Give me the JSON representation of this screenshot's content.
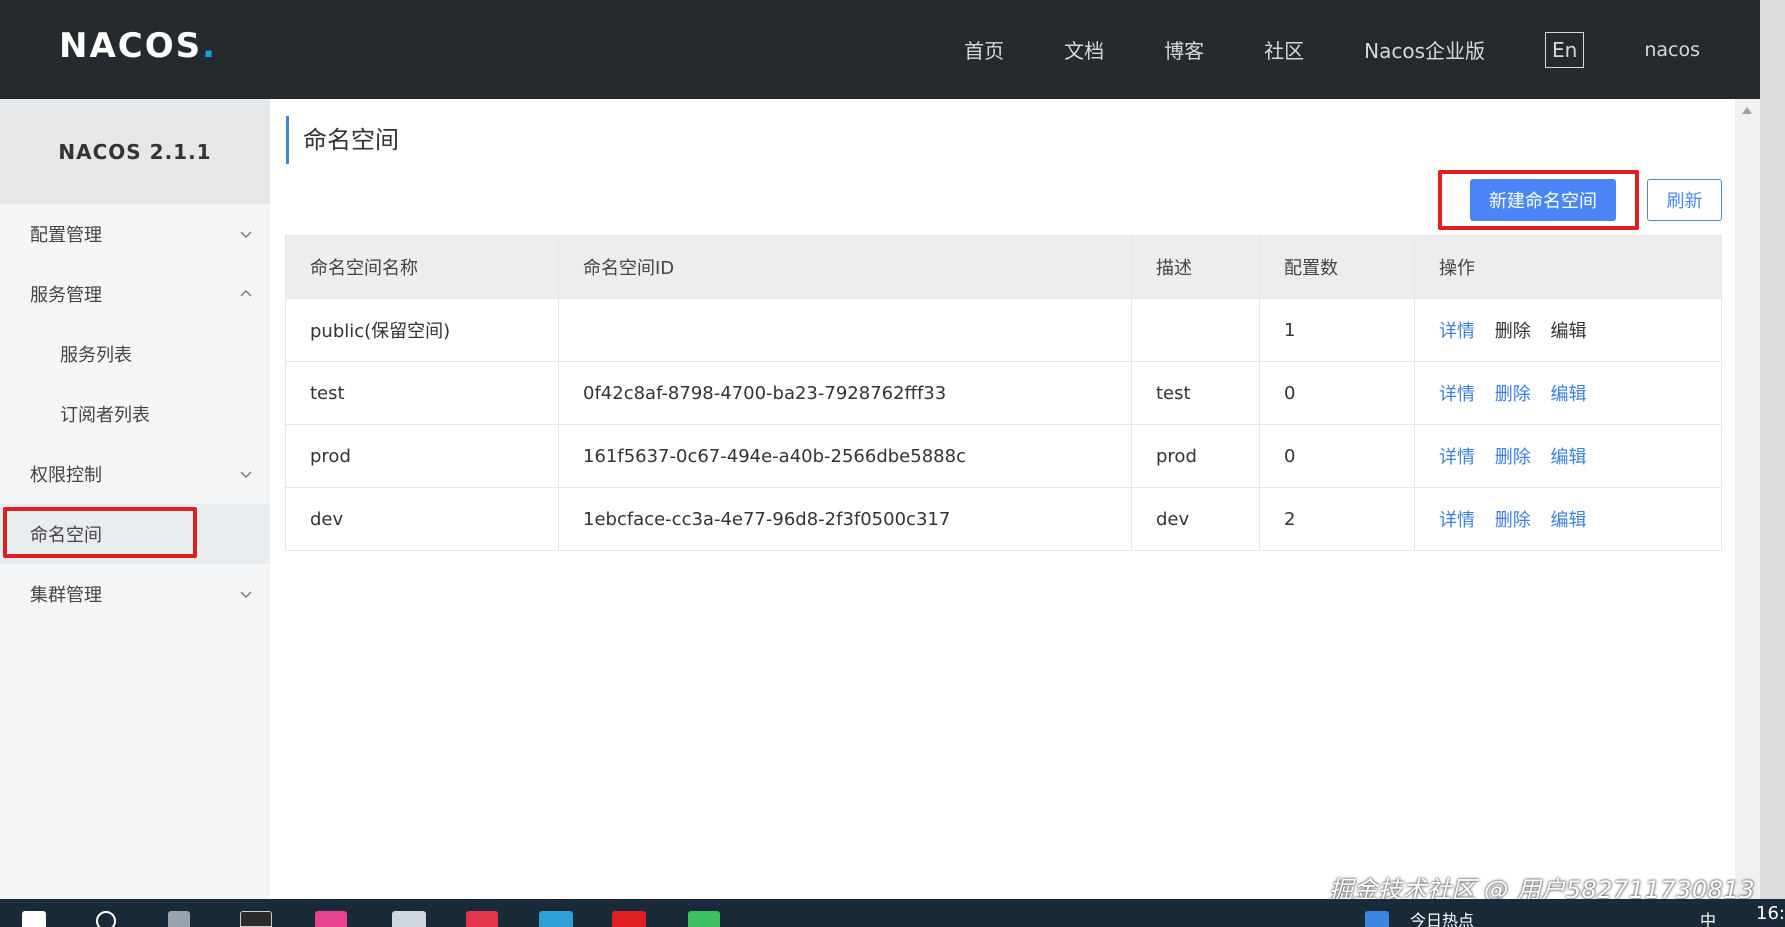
{
  "header": {
    "logo_text": "NACOS",
    "logo_dot": ".",
    "nav": [
      "首页",
      "文档",
      "博客",
      "社区",
      "Nacos企业版"
    ],
    "lang": "En",
    "user": "nacos"
  },
  "sidebar": {
    "version": "NACOS 2.1.1",
    "items": [
      {
        "label": "配置管理"
      },
      {
        "label": "服务管理"
      },
      {
        "label": "服务列表"
      },
      {
        "label": "订阅者列表"
      },
      {
        "label": "权限控制"
      },
      {
        "label": "命名空间"
      },
      {
        "label": "集群管理"
      }
    ]
  },
  "main": {
    "title": "命名空间",
    "new_button": "新建命名空间",
    "refresh_button": "刷新",
    "columns": [
      "命名空间名称",
      "命名空间ID",
      "描述",
      "配置数",
      "操作"
    ],
    "rows": [
      {
        "name": "public(保留空间)",
        "id": "",
        "desc": "",
        "count": "1"
      },
      {
        "name": "test",
        "id": "0f42c8af-8798-4700-ba23-7928762fff33",
        "desc": "test",
        "count": "0"
      },
      {
        "name": "prod",
        "id": "161f5637-0c67-494e-a40b-2566dbe5888c",
        "desc": "prod",
        "count": "0"
      },
      {
        "name": "dev",
        "id": "1ebcface-cc3a-4e77-96d8-2f3f0500c317",
        "desc": "dev",
        "count": "2"
      }
    ],
    "ops": {
      "detail": "详情",
      "delete": "删除",
      "edit": "编辑"
    }
  },
  "watermark": "掘金技术社区 @ 用户582711730813",
  "taskbar": {
    "clock": "16:",
    "news_text": "今日热点",
    "ime": "中"
  },
  "colors": {
    "header_bg": "#252a2f",
    "accent": "#4a86f5",
    "highlight": "#e02020",
    "link": "#3b7fe6"
  }
}
